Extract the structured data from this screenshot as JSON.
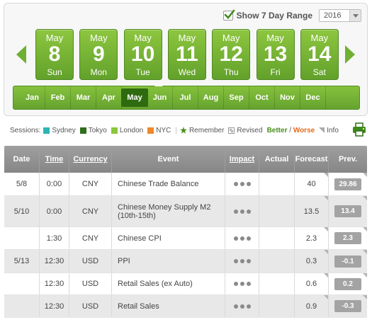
{
  "controls": {
    "show7_label": "Show 7 Day Range",
    "show7_checked": true,
    "year": "2016"
  },
  "days": [
    {
      "month": "May",
      "day": "8",
      "weekday": "Sun"
    },
    {
      "month": "May",
      "day": "9",
      "weekday": "Mon"
    },
    {
      "month": "May",
      "day": "10",
      "weekday": "Tue"
    },
    {
      "month": "May",
      "day": "11",
      "weekday": "Wed"
    },
    {
      "month": "May",
      "day": "12",
      "weekday": "Thu"
    },
    {
      "month": "May",
      "day": "13",
      "weekday": "Fri"
    },
    {
      "month": "May",
      "day": "14",
      "weekday": "Sat"
    }
  ],
  "months": [
    "Jan",
    "Feb",
    "Mar",
    "Apr",
    "May",
    "Jun",
    "Jul",
    "Aug",
    "Sep",
    "Oct",
    "Nov",
    "Dec"
  ],
  "active_month": "May",
  "legend": {
    "sessions_label": "Sessions:",
    "sessions": [
      {
        "label": "Sydney",
        "color": "#2bb5b5"
      },
      {
        "label": "Tokyo",
        "color": "#2f6e1a"
      },
      {
        "label": "London",
        "color": "#8cc63f"
      },
      {
        "label": "NYC",
        "color": "#f0872a"
      }
    ],
    "remember": "Remember",
    "revised": "Revised",
    "better": "Better",
    "slash": " / ",
    "worse": "Worse",
    "info": "Info"
  },
  "table": {
    "headers": {
      "date": "Date",
      "time": "Time",
      "currency": "Currency",
      "event": "Event",
      "impact": "Impact",
      "actual": "Actual",
      "forecast": "Forecast",
      "prev": "Prev."
    },
    "rows": [
      {
        "date": "5/8",
        "time": "0:00",
        "currency": "CNY",
        "event": "Chinese Trade Balance",
        "actual": "",
        "forecast": "40",
        "prev": "29.86",
        "shade": "white"
      },
      {
        "date": "5/10",
        "time": "0:00",
        "currency": "CNY",
        "event": "Chinese Money Supply M2 (10th-15th)",
        "actual": "",
        "forecast": "13.5",
        "prev": "13.4",
        "shade": "gray"
      },
      {
        "date": "",
        "time": "1:30",
        "currency": "CNY",
        "event": "Chinese CPI",
        "actual": "",
        "forecast": "2.3",
        "prev": "2.3",
        "shade": "white"
      },
      {
        "date": "5/13",
        "time": "12:30",
        "currency": "USD",
        "event": "PPI",
        "actual": "",
        "forecast": "0.3",
        "prev": "-0.1",
        "shade": "gray"
      },
      {
        "date": "",
        "time": "12:30",
        "currency": "USD",
        "event": "Retail Sales (ex Auto)",
        "actual": "",
        "forecast": "0.6",
        "prev": "0.2",
        "shade": "white"
      },
      {
        "date": "",
        "time": "12:30",
        "currency": "USD",
        "event": "Retail Sales",
        "actual": "",
        "forecast": "0.9",
        "prev": "-0.3",
        "shade": "gray"
      }
    ]
  }
}
